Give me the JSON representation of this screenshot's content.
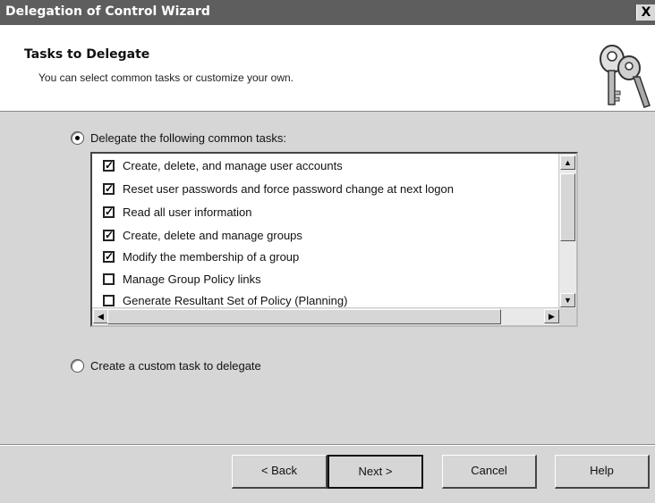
{
  "window": {
    "title": "Delegation of Control Wizard",
    "close_label": "X"
  },
  "header": {
    "title": "Tasks to Delegate",
    "subtitle": "You can select common tasks or customize your own.",
    "icon": "keys-icon"
  },
  "options": {
    "common": {
      "label": "Delegate the following common tasks:",
      "selected": true
    },
    "custom": {
      "label": "Create a custom task to delegate",
      "selected": false
    }
  },
  "tasks": [
    {
      "label": "Create, delete, and manage user accounts",
      "checked": true
    },
    {
      "label": "Reset user passwords and force password change at next logon",
      "checked": true
    },
    {
      "label": "Read all user information",
      "checked": true
    },
    {
      "label": "Create, delete and manage groups",
      "checked": true
    },
    {
      "label": "Modify the membership of a group",
      "checked": true
    },
    {
      "label": "Manage Group Policy links",
      "checked": false
    },
    {
      "label": "Generate Resultant Set of Policy (Planning)",
      "checked": false
    }
  ],
  "buttons": {
    "back": "< Back",
    "next": "Next >",
    "cancel": "Cancel",
    "help": "Help"
  },
  "colors": {
    "titlebar": "#5e5e5e",
    "dialog_bg": "#d6d6d6",
    "header_bg": "#ffffff"
  }
}
